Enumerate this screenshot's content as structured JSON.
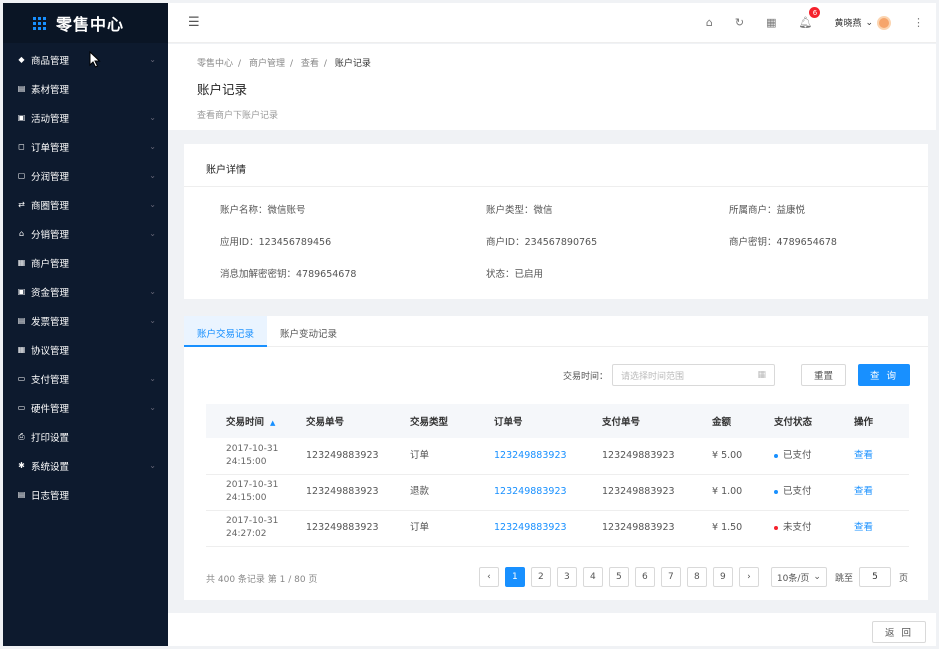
{
  "app": {
    "title": "零售中心"
  },
  "sidebar": {
    "items": [
      {
        "label": "商品管理",
        "icon": "tag-icon",
        "glyph": "◆",
        "has_children": true
      },
      {
        "label": "素材管理",
        "icon": "file-icon",
        "glyph": "▤",
        "has_children": false
      },
      {
        "label": "活动管理",
        "icon": "calendar-icon",
        "glyph": "▣",
        "has_children": true
      },
      {
        "label": "订单管理",
        "icon": "bookmark-icon",
        "glyph": "◻",
        "has_children": true
      },
      {
        "label": "分润管理",
        "icon": "box-icon",
        "glyph": "▢",
        "has_children": true
      },
      {
        "label": "商圈管理",
        "icon": "exchange-icon",
        "glyph": "⇄",
        "has_children": true
      },
      {
        "label": "分销管理",
        "icon": "home-icon",
        "glyph": "⌂",
        "has_children": true
      },
      {
        "label": "商户管理",
        "icon": "user-card-icon",
        "glyph": "▦",
        "has_children": false
      },
      {
        "label": "资金管理",
        "icon": "wallet-icon",
        "glyph": "▣",
        "has_children": true
      },
      {
        "label": "发票管理",
        "icon": "invoice-icon",
        "glyph": "▤",
        "has_children": true
      },
      {
        "label": "协议管理",
        "icon": "contract-icon",
        "glyph": "▦",
        "has_children": false
      },
      {
        "label": "支付管理",
        "icon": "card-icon",
        "glyph": "▭",
        "has_children": true
      },
      {
        "label": "硬件管理",
        "icon": "device-icon",
        "glyph": "▭",
        "has_children": true
      },
      {
        "label": "打印设置",
        "icon": "printer-icon",
        "glyph": "⎙",
        "has_children": false
      },
      {
        "label": "系统设置",
        "icon": "gear-icon",
        "glyph": "✱",
        "has_children": true
      },
      {
        "label": "日志管理",
        "icon": "log-icon",
        "glyph": "▤",
        "has_children": false
      }
    ]
  },
  "topbar": {
    "notification_count": "6",
    "user_name": "黄晓燕"
  },
  "breadcrumb": [
    "零售中心",
    "商户管理",
    "查看",
    "账户记录"
  ],
  "page": {
    "title": "账户记录",
    "description": "查看商户下账户记录"
  },
  "detail": {
    "title": "账户详情",
    "fields": [
      "账户名称：微信账号",
      "账户类型：微信",
      "所属商户：益康悦",
      "应用ID：123456789456",
      "商户ID：234567890765",
      "商户密钥：4789654678",
      "消息加解密密钥：4789654678",
      "状态：已启用"
    ]
  },
  "tabs": [
    "账户交易记录",
    "账户变动记录"
  ],
  "filter": {
    "label": "交易时间：",
    "placeholder": "请选择时间范围",
    "reset": "重置",
    "query": "查 询"
  },
  "table": {
    "headers": [
      "交易时间",
      "交易单号",
      "交易类型",
      "订单号",
      "支付单号",
      "金额",
      "支付状态",
      "操作"
    ],
    "rows": [
      {
        "date": "2017-10-31",
        "time": "24:15:00",
        "trade_no": "123249883923",
        "type": "订单",
        "order_no": "123249883923",
        "pay_no": "123249883923",
        "amount": "¥ 5.00",
        "status": "已支付",
        "status_color": "#1890ff",
        "action": "查看"
      },
      {
        "date": "2017-10-31",
        "time": "24:15:00",
        "trade_no": "123249883923",
        "type": "退款",
        "order_no": "123249883923",
        "pay_no": "123249883923",
        "amount": "¥ 1.00",
        "status": "已支付",
        "status_color": "#1890ff",
        "action": "查看"
      },
      {
        "date": "2017-10-31",
        "time": "24:27:02",
        "trade_no": "123249883923",
        "type": "订单",
        "order_no": "123249883923",
        "pay_no": "123249883923",
        "amount": "¥ 1.50",
        "status": "未支付",
        "status_color": "#f5222d",
        "action": "查看"
      }
    ]
  },
  "pagination": {
    "summary": "共 400 条记录 第 1 / 80 页",
    "pages": [
      "1",
      "2",
      "3",
      "4",
      "5",
      "6",
      "7",
      "8",
      "9"
    ],
    "current": "1",
    "page_size": "10条/页",
    "jump_label": "跳至",
    "jump_value": "5",
    "page_unit": "页"
  },
  "footer": {
    "back": "返 回"
  },
  "colors": {
    "primary": "#1890ff",
    "sidebar_bg": "#0d1a2e",
    "danger": "#f5222d"
  }
}
